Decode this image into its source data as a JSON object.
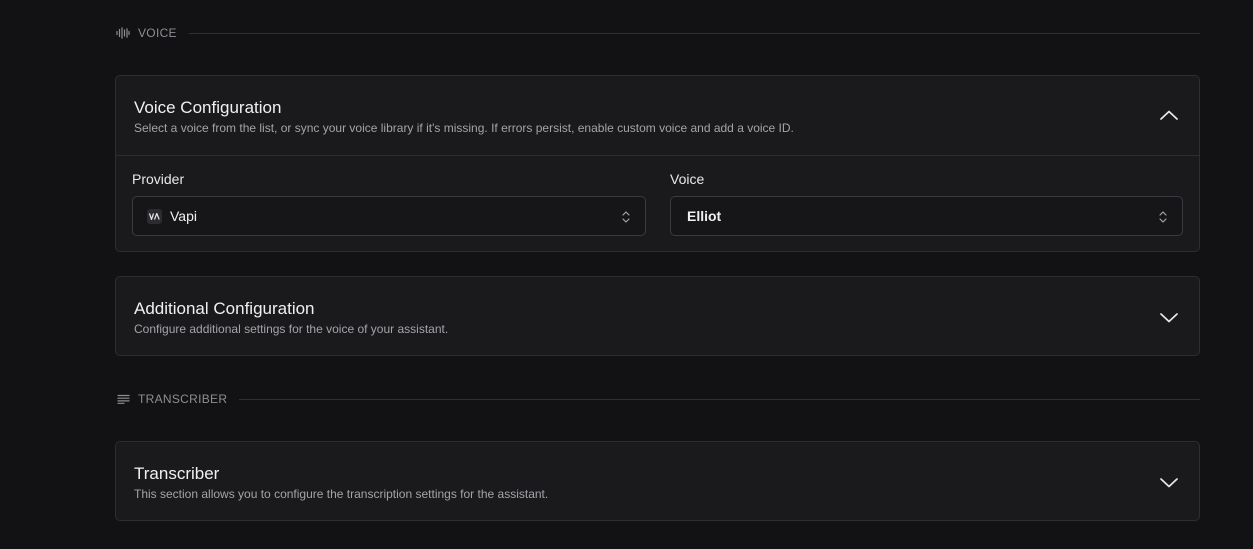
{
  "voice_section": {
    "label": "VOICE",
    "icon": "audio-waveform-icon"
  },
  "voice_config": {
    "title": "Voice Configuration",
    "description": "Select a voice from the list, or sync your voice library if it's missing. If errors persist, enable custom voice and add a voice ID.",
    "expanded": true,
    "provider": {
      "label": "Provider",
      "value": "Vapi",
      "logo_icon": "vapi-logo-icon"
    },
    "voice": {
      "label": "Voice",
      "value": "Elliot"
    }
  },
  "additional_config": {
    "title": "Additional Configuration",
    "description": "Configure additional settings for the voice of your assistant.",
    "expanded": false
  },
  "transcriber_section": {
    "label": "TRANSCRIBER",
    "icon": "text-lines-icon"
  },
  "transcriber": {
    "title": "Transcriber",
    "description": "This section allows you to configure the transcription settings for the assistant.",
    "expanded": false
  },
  "colors": {
    "background": "#121214",
    "card": "#1a1a1d",
    "border": "#2d2d32",
    "muted_text": "#a3a3aa"
  }
}
